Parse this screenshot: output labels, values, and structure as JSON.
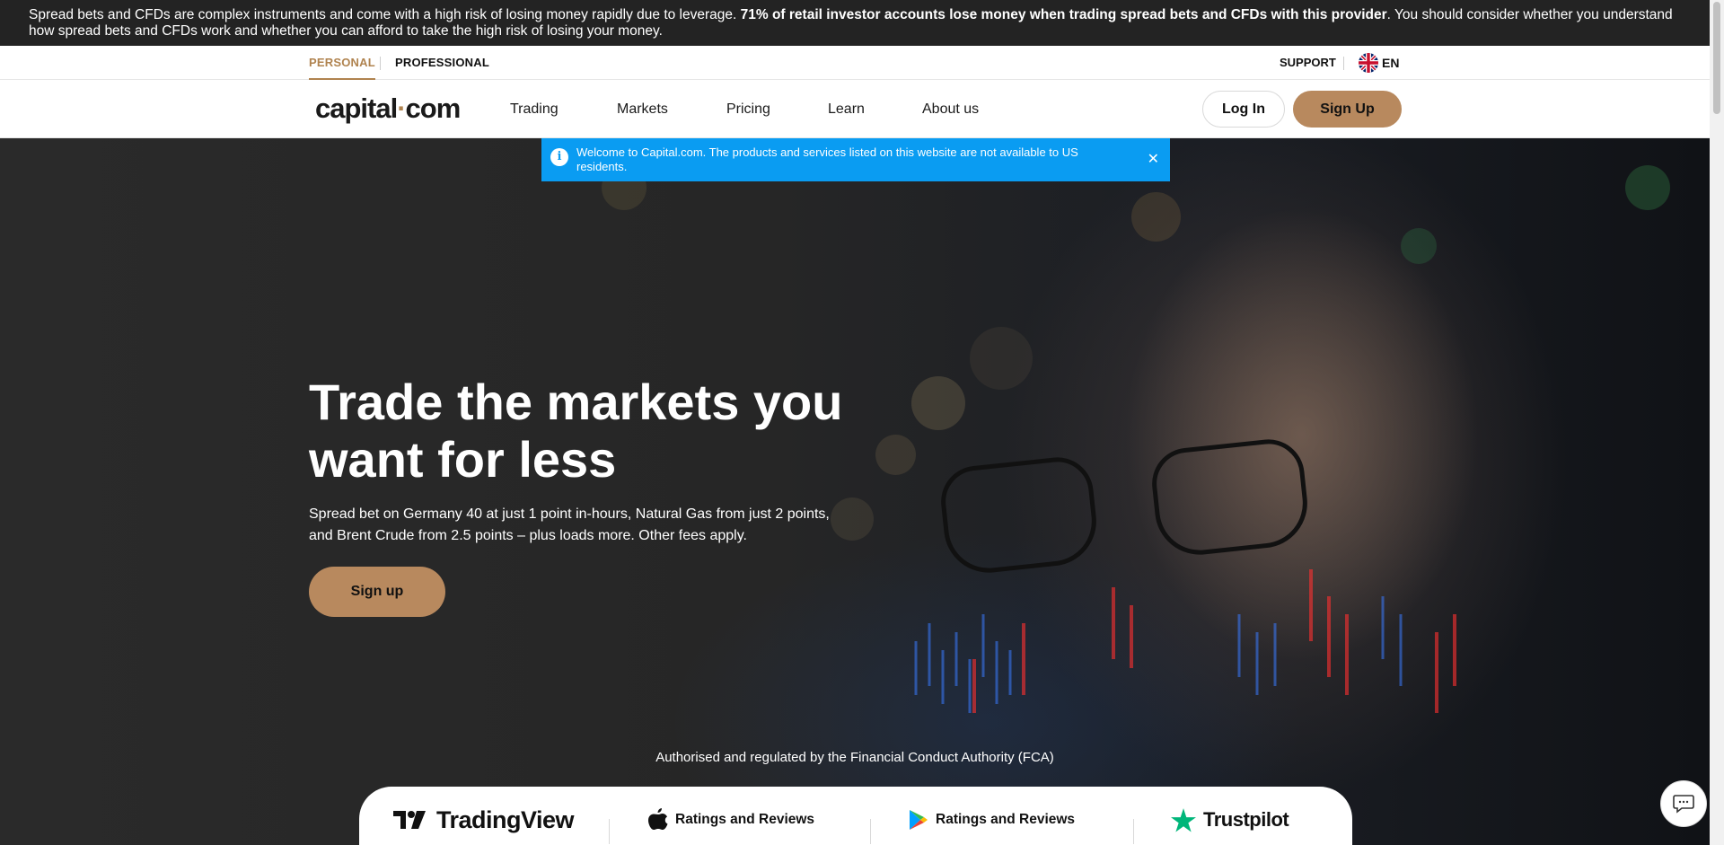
{
  "risk_warning": {
    "part1": "Spread bets and CFDs are complex instruments and come with a high risk of losing money rapidly due to leverage. ",
    "bold": "71% of retail investor accounts lose money when trading spread bets and CFDs with this provider",
    "part2": ". You should consider whether you understand how spread bets and CFDs work and whether you can afford to take the high risk of losing your money."
  },
  "segments": {
    "personal": "PERSONAL",
    "professional": "PROFESSIONAL"
  },
  "top_right": {
    "support": "SUPPORT",
    "language": "EN"
  },
  "nav": {
    "logo_part1": "capital",
    "logo_dot": "·",
    "logo_part2": "com",
    "items": [
      "Trading",
      "Markets",
      "Pricing",
      "Learn",
      "About us"
    ],
    "login": "Log In",
    "signup": "Sign Up"
  },
  "banner": {
    "icon": "info-icon",
    "message": "Welcome to Capital.com. The products and services listed on this website are not available to US residents.",
    "close": "✕"
  },
  "hero": {
    "title": "Trade the markets you want for less",
    "subtitle": "Spread bet on Germany 40 at just 1 point in-hours, Natural Gas from just 2 points, and Brent Crude from 2.5 points – plus loads more. Other fees apply.",
    "cta": "Sign up",
    "regulation": "Authorised and regulated by the Financial Conduct Authority (FCA)"
  },
  "ratings": [
    {
      "icon": "tradingview-logo-icon",
      "label": "TradingView"
    },
    {
      "icon": "apple-icon",
      "label": "Ratings and Reviews"
    },
    {
      "icon": "google-play-icon",
      "label": "Ratings and Reviews"
    },
    {
      "icon": "trustpilot-star-icon",
      "label": "Trustpilot"
    }
  ],
  "colors": {
    "brand_gold": "#b8895e",
    "banner_blue": "#0a9cf2",
    "risk_bar_bg": "#232323",
    "trustpilot_green": "#00b67a"
  }
}
